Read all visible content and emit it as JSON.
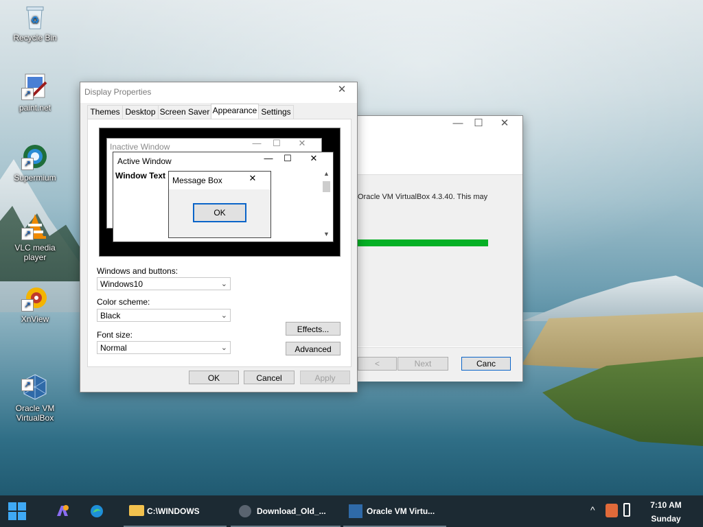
{
  "desktop": {
    "icons": [
      {
        "label": "Recycle Bin"
      },
      {
        "label": "paint.net"
      },
      {
        "label": "Supermium"
      },
      {
        "label": "VLC media player"
      },
      {
        "label": "XnView"
      },
      {
        "label": "Oracle VM\nVirtualBox"
      }
    ]
  },
  "vbox": {
    "message": "Oracle VM VirtualBox 4.3.40. This may",
    "back_label": "<",
    "next_label": "Next",
    "cancel_label": "Canc",
    "progress_color": "#06b025"
  },
  "dialog": {
    "title": "Display Properties",
    "close_glyph": "✕",
    "tabs": [
      "Themes",
      "Desktop",
      "Screen Saver",
      "Appearance",
      "Settings"
    ],
    "active_tab": "Appearance",
    "preview": {
      "inactive_title": "Inactive Window",
      "active_title": "Active Window",
      "window_text": "Window Text",
      "message_title": "Message Box",
      "ok_label": "OK"
    },
    "windows_buttons_label": "Windows and buttons:",
    "windows_buttons_value": "Windows10",
    "color_scheme_label": "Color scheme:",
    "color_scheme_value": "Black",
    "font_size_label": "Font size:",
    "font_size_value": "Normal",
    "effects_label": "Effects...",
    "advanced_label": "Advanced",
    "ok_label": "OK",
    "cancel_label": "Cancel",
    "apply_label": "Apply"
  },
  "taskbar": {
    "explorer_label": "C:\\WINDOWS",
    "download_label": "Download_Old_...",
    "vbox_label": "Oracle VM Virtu...",
    "time": "7:10 AM",
    "day": "Sunday"
  }
}
